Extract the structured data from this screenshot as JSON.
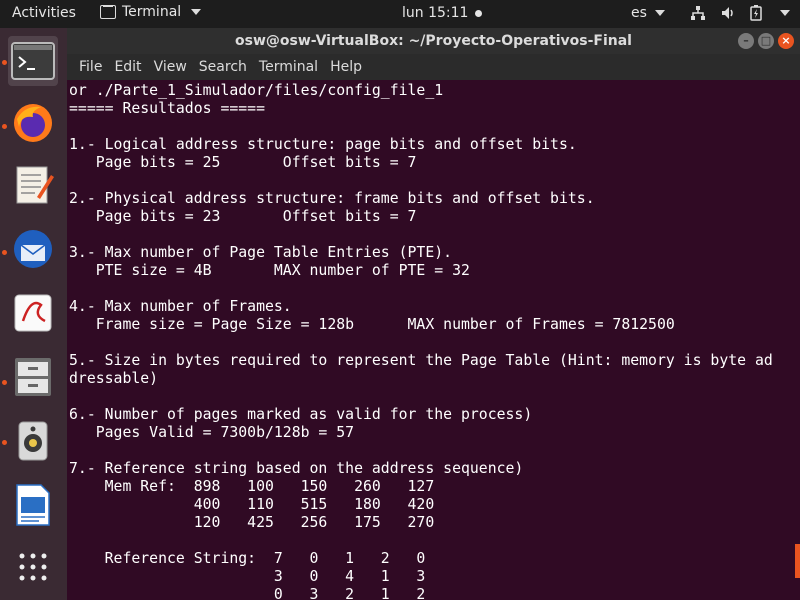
{
  "topbar": {
    "activities": "Activities",
    "app_name": "Terminal",
    "clock": "lun 15:11",
    "lang": "es"
  },
  "dock": {
    "items": [
      {
        "name": "terminal-icon"
      },
      {
        "name": "firefox-icon"
      },
      {
        "name": "text-editor-icon"
      },
      {
        "name": "thunderbird-icon"
      },
      {
        "name": "document-viewer-icon"
      },
      {
        "name": "file-cabinet-icon"
      },
      {
        "name": "speaker-icon"
      },
      {
        "name": "writer-icon"
      },
      {
        "name": "app-grid-icon"
      }
    ]
  },
  "window": {
    "title": "osw@osw-VirtualBox: ~/Proyecto-Operativos-Final",
    "menu": [
      "File",
      "Edit",
      "View",
      "Search",
      "Terminal",
      "Help"
    ]
  },
  "terminal": {
    "lines": [
      "or ./Parte_1_Simulador/files/config_file_1",
      "===== Resultados =====",
      "",
      "1.- Logical address structure: page bits and offset bits.",
      "   Page bits = 25       Offset bits = 7",
      "",
      "2.- Physical address structure: frame bits and offset bits.",
      "   Page bits = 23       Offset bits = 7",
      "",
      "3.- Max number of Page Table Entries (PTE).",
      "   PTE size = 4B       MAX number of PTE = 32",
      "",
      "4.- Max number of Frames.",
      "   Frame size = Page Size = 128b      MAX number of Frames = 7812500",
      "",
      "5.- Size in bytes required to represent the Page Table (Hint: memory is byte ad",
      "dressable)",
      "",
      "6.- Number of pages marked as valid for the process)",
      "   Pages Valid = 7300b/128b = 57",
      "",
      "7.- Reference string based on the address sequence)",
      "    Mem Ref:  898   100   150   260   127",
      "              400   110   515   180   420",
      "              120   425   256   175   270",
      "",
      "    Reference String:  7   0   1   2   0",
      "                       3   0   4   1   3",
      "                       0   3   2   1   2"
    ]
  }
}
